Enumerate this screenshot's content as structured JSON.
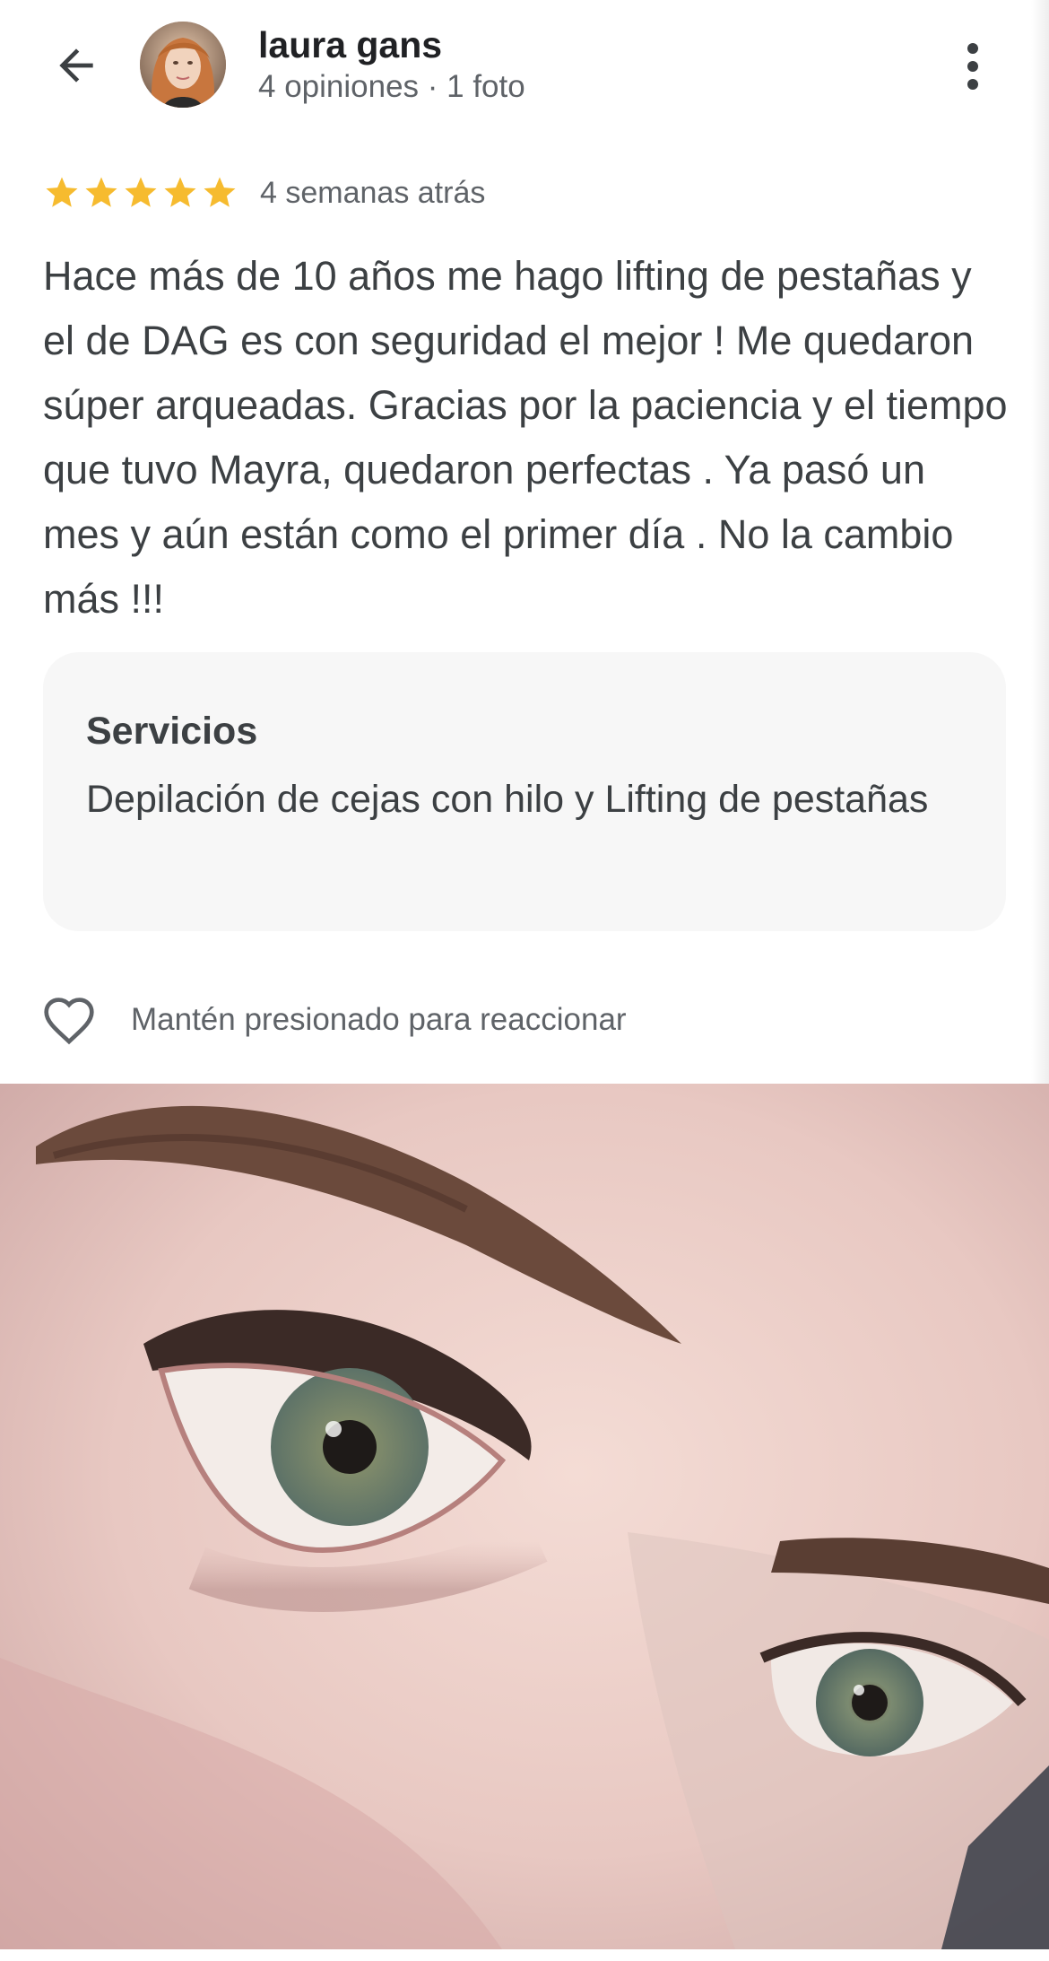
{
  "header": {
    "back_icon": "arrow-left-icon",
    "user_name": "laura gans",
    "user_meta": "4 opiniones · 1 foto",
    "more_icon": "more-vertical-icon"
  },
  "review": {
    "rating": 5,
    "rating_max": 5,
    "star_color": "#f6bb2f",
    "date": "4 semanas atrás",
    "text": "Hace más de 10 años me hago lifting de pestañas y el de DAG es con seguridad el mejor ! Me quedaron súper arqueadas. Gracias por la paciencia y el tiempo que tuvo Mayra, quedaron perfectas . Ya pasó un mes y aún están como el primer día . No la cambio más !!!"
  },
  "services": {
    "title": "Servicios",
    "text": "Depilación de cejas con hilo y Lifting de pestañas"
  },
  "reaction": {
    "icon": "heart-outline-icon",
    "label": "Mantén presionado para reaccionar"
  }
}
